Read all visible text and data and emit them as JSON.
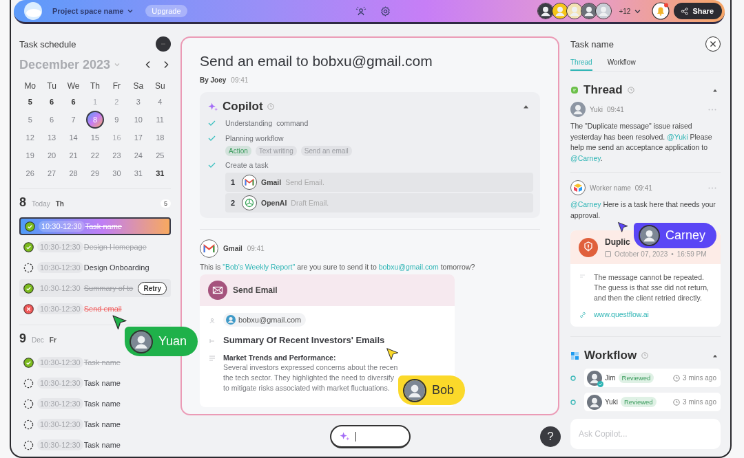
{
  "topbar": {
    "project": "Project space name",
    "upgrade": "Upgrade",
    "more": "+12",
    "share": "Share"
  },
  "schedule": {
    "title": "Task schedule",
    "month": "December 2023",
    "weekdays": [
      "Mo",
      "Tu",
      "We",
      "Th",
      "Fr",
      "Sa",
      "Su"
    ],
    "days": [
      {
        "label": "5",
        "kind": "strong",
        "selected": false
      },
      {
        "label": "6",
        "kind": "strong",
        "selected": false
      },
      {
        "label": "6",
        "kind": "strong",
        "selected": false
      },
      {
        "label": "1",
        "kind": "faint",
        "selected": false
      },
      {
        "label": "2",
        "kind": "faint",
        "selected": false
      },
      {
        "label": "3",
        "kind": "normal",
        "selected": false
      },
      {
        "label": "4",
        "kind": "normal",
        "selected": false
      },
      {
        "label": "5",
        "kind": "normal",
        "selected": false
      },
      {
        "label": "6",
        "kind": "normal",
        "selected": false
      },
      {
        "label": "7",
        "kind": "normal",
        "selected": false
      },
      {
        "label": "8",
        "kind": "normal",
        "selected": true
      },
      {
        "label": "9",
        "kind": "normal",
        "selected": false
      },
      {
        "label": "10",
        "kind": "normal",
        "selected": false
      },
      {
        "label": "11",
        "kind": "normal",
        "selected": false
      },
      {
        "label": "12",
        "kind": "normal",
        "selected": false
      },
      {
        "label": "13",
        "kind": "normal",
        "selected": false
      },
      {
        "label": "14",
        "kind": "normal",
        "selected": false
      },
      {
        "label": "15",
        "kind": "normal",
        "selected": false
      },
      {
        "label": "16",
        "kind": "faint",
        "selected": false
      },
      {
        "label": "17",
        "kind": "normal",
        "selected": false
      },
      {
        "label": "18",
        "kind": "normal",
        "selected": false
      },
      {
        "label": "19",
        "kind": "normal",
        "selected": false
      },
      {
        "label": "20",
        "kind": "normal",
        "selected": false
      },
      {
        "label": "21",
        "kind": "normal",
        "selected": false
      },
      {
        "label": "22",
        "kind": "normal",
        "selected": false
      },
      {
        "label": "23",
        "kind": "normal",
        "selected": false
      },
      {
        "label": "24",
        "kind": "normal",
        "selected": false
      },
      {
        "label": "25",
        "kind": "normal",
        "selected": false
      },
      {
        "label": "26",
        "kind": "normal",
        "selected": false
      },
      {
        "label": "27",
        "kind": "normal",
        "selected": false
      },
      {
        "label": "28",
        "kind": "normal",
        "selected": false
      },
      {
        "label": "29",
        "kind": "normal",
        "selected": false
      },
      {
        "label": "30",
        "kind": "normal",
        "selected": false
      },
      {
        "label": "31",
        "kind": "normal",
        "selected": false
      },
      {
        "label": "31",
        "kind": "strong",
        "selected": false
      }
    ]
  },
  "task_groups": [
    {
      "day": "8",
      "label": "Today",
      "weekday": "Th",
      "count": "5",
      "tasks": [
        {
          "time": "10:30-12:30",
          "name": "Task name",
          "kind": "done",
          "selected": true
        },
        {
          "time": "10:30-12:30",
          "name": "Design Homepage",
          "kind": "done",
          "selected": false
        },
        {
          "time": "10:30-12:30",
          "name": "Design Onboarding",
          "kind": "pending",
          "selected": false
        },
        {
          "time": "10:30-12:30",
          "name": "Summary of to",
          "kind": "done",
          "selected": false,
          "action": "Retry"
        },
        {
          "time": "10:30-12:30",
          "name": "Send email",
          "kind": "failed",
          "selected": false
        }
      ]
    },
    {
      "day": "9",
      "label": "Dec",
      "weekday": "Fr",
      "tasks": [
        {
          "time": "10:30-12:30",
          "name": "Task name",
          "kind": "done",
          "selected": false
        },
        {
          "time": "10:30-12:30",
          "name": "Task name",
          "kind": "pending",
          "selected": false
        },
        {
          "time": "10:30-12:30",
          "name": "Task name",
          "kind": "pending",
          "selected": false
        },
        {
          "time": "10:30-12:30",
          "name": "Task name",
          "kind": "pending",
          "selected": false
        },
        {
          "time": "10:30-12:30",
          "name": "Task name",
          "kind": "pending",
          "selected": false
        }
      ]
    }
  ],
  "task": {
    "title": "Send an email to bobxu@gmail.com",
    "author": "By Joey",
    "time": "09:41"
  },
  "copilot": {
    "title": "Copilot",
    "expanded": true,
    "steps": [
      {
        "label": "Understanding  command",
        "done": true
      },
      {
        "label": "Planning workflow",
        "done": true,
        "tags": [
          {
            "label": "Action",
            "color": "#3a9b5c"
          },
          {
            "label": "Text writing",
            "color": "#9a9ca1"
          },
          {
            "label": "Send an email",
            "color": "#9a9ca1"
          }
        ]
      },
      {
        "label": "Create a task",
        "done": true,
        "subtasks": [
          {
            "index": "1",
            "app": "Gmail",
            "kind": "gmail",
            "action": "Send Email."
          },
          {
            "index": "2",
            "app": "OpenAI",
            "kind": "openai",
            "action": "Draft Email."
          }
        ]
      }
    ]
  },
  "message": {
    "sender": "Gmail",
    "time": "09:41",
    "parts": [
      {
        "text": "This is ",
        "link": false
      },
      {
        "text": "\"Bob's Weekly Report\"",
        "link": true
      },
      {
        "text": " are you sure to send it to ",
        "link": false
      },
      {
        "text": "bobxu@gmail.com",
        "link": true
      },
      {
        "text": " tomorrow?",
        "link": false
      }
    ]
  },
  "email_card": {
    "title": "Send Email",
    "recipient": "bobxu@gmail.com",
    "subject": "Summary Of Recent Investors' Emails",
    "heading": "Market Trends and Performance:",
    "body_lines": [
      "Several investors expressed concerns about the recen",
      "the tech sector. They highlighted the need to diversify",
      "to mitigate risks associated with market fluctuations."
    ]
  },
  "help": "?",
  "detail": {
    "title": "Task name",
    "tabs": [
      {
        "label": "Thread",
        "selected": true
      },
      {
        "label": "Workflow",
        "selected": false
      }
    ]
  },
  "thread": {
    "title": "Thread",
    "expanded": true,
    "messages": [
      {
        "author": "Yuki",
        "time": "09:41",
        "kind": "person",
        "parts": [
          {
            "text": "The \"Duplicate message\" issue raised yesterday has been resolved. ",
            "link": false
          },
          {
            "text": "@Yuki",
            "link": true
          },
          {
            "text": " Please help me send an acceptance application to ",
            "link": false
          },
          {
            "text": "@Carney",
            "link": true
          },
          {
            "text": ".",
            "link": false
          }
        ]
      },
      {
        "author": "Worker name",
        "time": "09:41",
        "kind": "bot",
        "parts": [
          {
            "text": "@Carney",
            "link": true
          },
          {
            "text": " Here is a task here that needs your approval.",
            "link": false
          }
        ]
      }
    ]
  },
  "alert": {
    "title": "Duplic",
    "date": "October 07, 2023",
    "separator": "•",
    "time": "16:59 PM",
    "body": "The message cannot be repeated. The guess is that sse did not return, and then the client retried directly.",
    "link": "www.questflow.ai"
  },
  "workflow": {
    "title": "Workflow",
    "expanded": true,
    "items": [
      {
        "name": "Jim",
        "status": "Reviewed",
        "time": "3 mins ago",
        "verified": true
      },
      {
        "name": "Yuki",
        "status": "Reviewed",
        "time": "3 mins ago",
        "verified": false
      }
    ]
  },
  "ask": {
    "placeholder": "Ask Copilot..."
  },
  "collaborators": [
    {
      "name": "Yuan",
      "color": "#1fb14a"
    },
    {
      "name": "Bob",
      "color": "#fbd92a"
    },
    {
      "name": "Carney",
      "color": "#5a46f5"
    }
  ]
}
